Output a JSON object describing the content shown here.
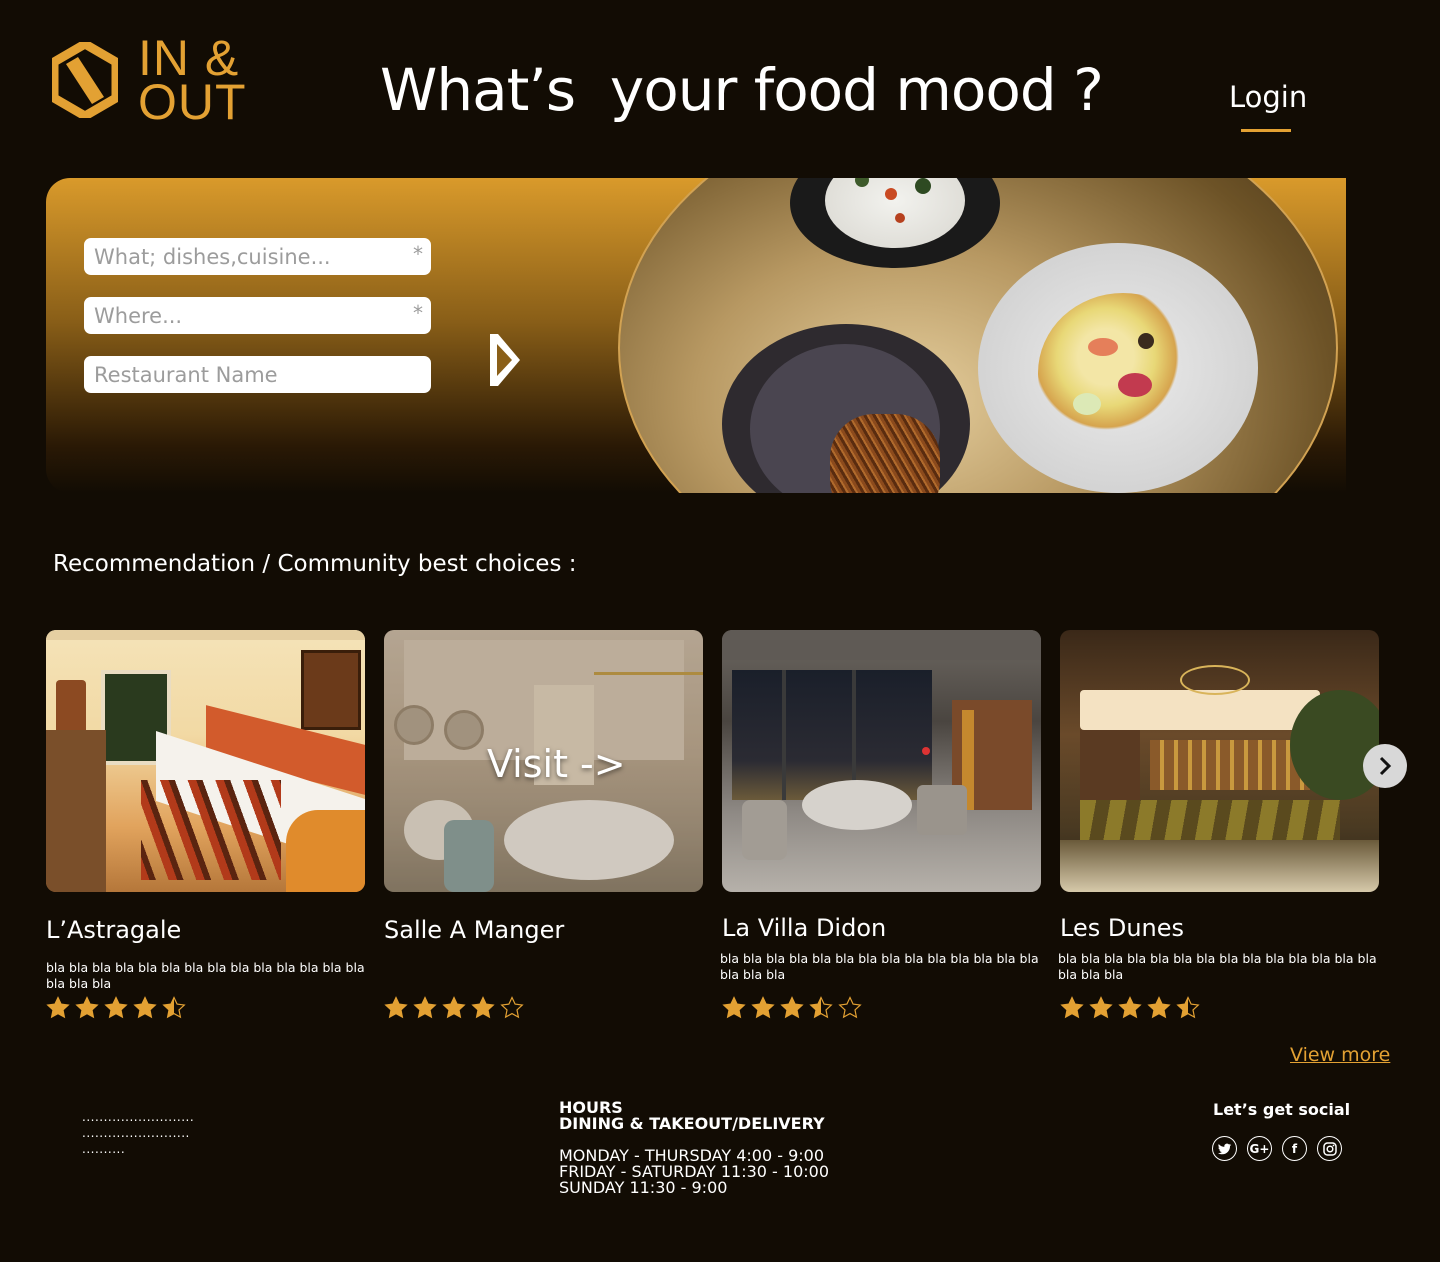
{
  "header": {
    "logo_text_line1": "IN &",
    "logo_text_line2": "OUT",
    "headline": "What’s  your food mood ?",
    "login_label": "Login"
  },
  "search": {
    "what_placeholder": "What; dishes,cuisine...",
    "where_placeholder": "Where...",
    "name_placeholder": "Restaurant Name",
    "required_mark": "*"
  },
  "recommendations": {
    "title": "Recommendation / Community best choices :",
    "visit_label": "Visit ->",
    "view_more_label": "View more",
    "cards": [
      {
        "name": "L’Astragale",
        "description": "bla bla bla bla bla bla bla bla bla bla bla bla bla bla bla bla bla",
        "rating": 4.5
      },
      {
        "name": "Salle A Manger",
        "description": "",
        "rating": 4
      },
      {
        "name": "La Villa Didon",
        "description": "bla bla bla bla bla bla bla bla bla bla bla bla bla bla bla bla bla",
        "rating": 3.5
      },
      {
        "name": "Les Dunes",
        "description": "bla bla bla bla bla bla bla bla bla bla bla bla bla bla bla bla bla",
        "rating": 4.5
      }
    ]
  },
  "footer": {
    "dots_line1": "..........................",
    "dots_line2": ".........................",
    "dots_line3": "..........",
    "hours_title": "HOURS",
    "hours_subtitle": "DINING & TAKEOUT/DELIVERY",
    "hours_line1": "MONDAY - THURSDAY 4:00 - 9:00",
    "hours_line2": "FRIDAY - SATURDAY 11:30 - 10:00",
    "hours_line3": "SUNDAY 11:30 - 9:00",
    "social_title": "Let’s get social",
    "social_icons": [
      "twitter-icon",
      "google-plus-icon",
      "facebook-icon",
      "instagram-icon"
    ]
  },
  "colors": {
    "background": "#120c04",
    "accent": "#e3a133"
  }
}
